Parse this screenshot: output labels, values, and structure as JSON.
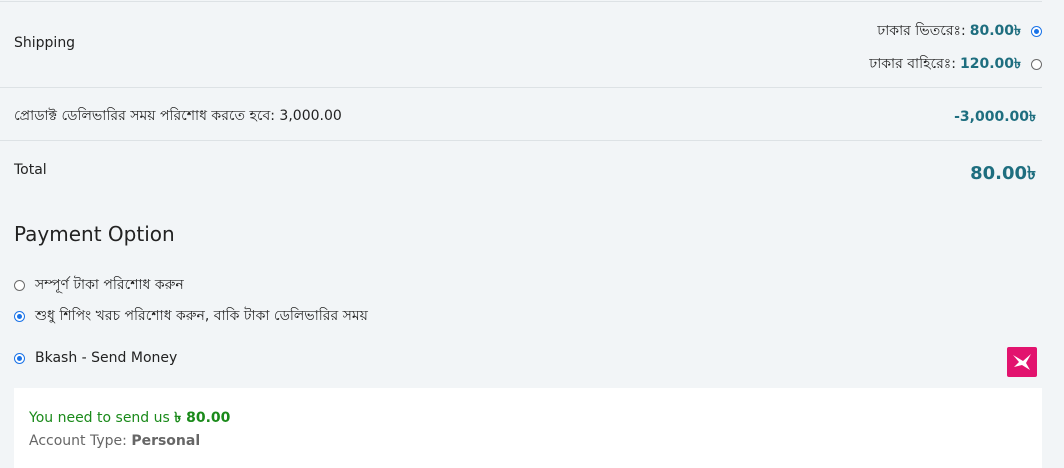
{
  "shipping": {
    "label": "Shipping",
    "options": [
      {
        "text": "ঢাকার ভিতরেঃ:",
        "amount": "80.00৳",
        "selected": true
      },
      {
        "text": "ঢাকার বাহিরেঃ:",
        "amount": "120.00৳",
        "selected": false
      }
    ]
  },
  "cod_row": {
    "label": "প্রোডাক্ট ডেলিভারির সময় পরিশোধ করতে হবে: 3,000.00",
    "value": "-3,000.00৳"
  },
  "total": {
    "label": "Total",
    "value": "80.00৳"
  },
  "payment": {
    "heading": "Payment Option",
    "options": [
      {
        "label": "সম্পূর্ণ টাকা পরিশোধ করুন",
        "selected": false
      },
      {
        "label": "শুধু শিপিং খরচ পরিশোধ করুন, বাকি টাকা ডেলিভারির সময়",
        "selected": true
      }
    ],
    "method": {
      "label": "Bkash - Send Money",
      "selected": true,
      "logo_icon": "bkash-bird-icon",
      "brand_color": "#e2136e"
    }
  },
  "bkash_panel": {
    "send_prefix": "You need to send us",
    "send_amount": "৳ 80.00",
    "account_prefix": "Account Type:",
    "account_type": "Personal"
  },
  "colors": {
    "accent": "#1e6e7f",
    "radio_checked": "#1a73e8",
    "success_text": "#1a8a1a",
    "background": "#f2f5f7"
  }
}
